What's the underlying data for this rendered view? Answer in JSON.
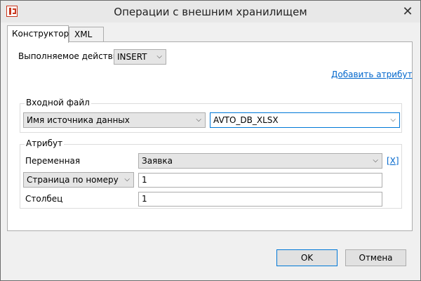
{
  "window": {
    "title": "Операции с внешним хранилищем",
    "close": "✕",
    "icon": "app-logo-icon"
  },
  "tabs": [
    {
      "label": "Конструктор",
      "active": true
    },
    {
      "label": "XML",
      "active": false
    }
  ],
  "action": {
    "label": "Выполняемое действие",
    "value": "INSERT"
  },
  "add_attribute_link": "Добавить атрибут",
  "input_file": {
    "group_title": "Входной файл",
    "source_select": "Имя источника данных",
    "source_value": "AVTO_DB_XLSX"
  },
  "attribute": {
    "group_title": "Атрибут",
    "variable_label": "Переменная",
    "variable_value": "Заявка",
    "remove_link": "[X]",
    "page_select": "Страница по номеру",
    "page_value": "1",
    "column_label": "Столбец",
    "column_value": "1"
  },
  "buttons": {
    "ok": "OK",
    "cancel": "Отмена"
  },
  "colors": {
    "link": "#0066cc",
    "focus_border": "#0078d7",
    "brand_icon": "#c8361e"
  },
  "icons": {
    "chevron": "chevron-down-icon"
  }
}
